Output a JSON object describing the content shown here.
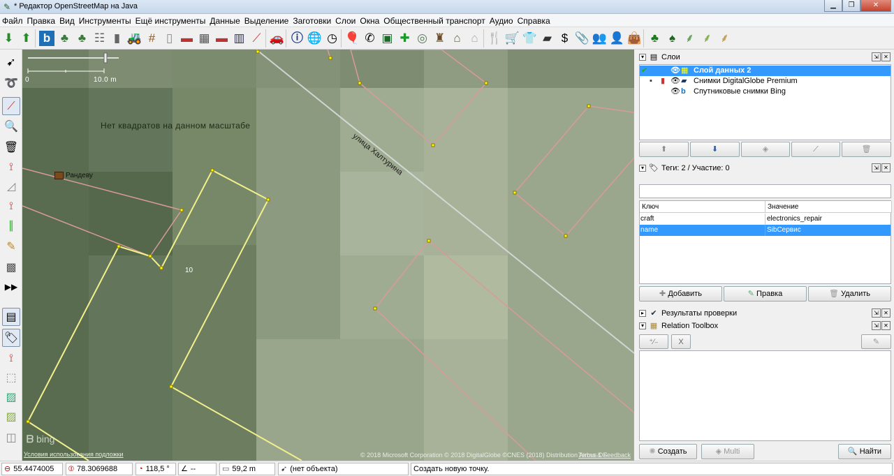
{
  "window": {
    "title": "* Редактор OpenStreetMap на Java",
    "min_icon": "minimize-icon",
    "max_icon": "maximize-icon",
    "close_icon": "close-icon"
  },
  "menu": [
    "Файл",
    "Правка",
    "Вид",
    "Инструменты",
    "Ещё инструменты",
    "Данные",
    "Выделение",
    "Заготовки",
    "Слои",
    "Окна",
    "Общественный транспорт",
    "Аудио",
    "Справка"
  ],
  "toolbar_icons": [
    "download-icon",
    "upload-icon",
    "bing-icon",
    "tree-icon",
    "tree-icon",
    "ladder-icon",
    "barrier-icon",
    "tractor-icon",
    "rails-icon",
    "hydrant-icon",
    "wall-icon",
    "fence-icon",
    "brick-icon",
    "gate-icon",
    "boom-barrier-icon",
    "car-icon",
    "info-icon",
    "globe-icon",
    "clock-icon",
    "balloons-icon",
    "phone-icon",
    "chalkboard-icon",
    "cross-icon",
    "stadium-icon",
    "castle-icon",
    "factory-icon",
    "house-icon",
    "cutlery-icon",
    "cart-icon",
    "shirt-icon",
    "car-repair-icon",
    "dollar-icon",
    "clip-icon",
    "people-icon",
    "person-icon",
    "bag-icon",
    "trees-icon",
    "forest-icon",
    "grass-icon",
    "meadow-icon",
    "wheat-icon"
  ],
  "left_tools": [
    "select-icon",
    "lasso-icon",
    "draw-icon",
    "zoom-icon",
    "delete-icon",
    "split-icon",
    "improve-way-icon",
    "extrude-icon",
    "parallel-icon",
    "pencil-icon",
    "building-icon",
    "more-icon",
    "toggle-dialogs-icon",
    "tag-panel-icon",
    "validation-icon",
    "relation-icon",
    "image-icon",
    "map-icon",
    "filter-icon"
  ],
  "map": {
    "scale_label": "10.0 m",
    "scale_zero": "0",
    "no_tiles": "Нет квадратов на данном масштабе",
    "street": "улица Халтурина",
    "poi_name": "Рандеву",
    "poi_icon": "cafe-icon",
    "house_number": "10",
    "bing_logo": "bing",
    "attribution": "© 2018 Microsoft Corporation © 2018 DigitalGlobe ©CNES (2018) Distribution Airbus DS",
    "terms": "Условия использования подложки",
    "terms_right": "Terms & Feedback"
  },
  "layers_panel": {
    "title": "Слои",
    "layers": [
      {
        "name": "Слой данных 2",
        "selected": true
      },
      {
        "name": "Снимки DigitalGlobe Premium",
        "selected": false
      },
      {
        "name": "Спутниковые снимки Bing",
        "selected": false
      }
    ],
    "buttons": [
      "move-up-icon",
      "move-down-icon",
      "merge-icon",
      "opacity-icon",
      "delete-icon"
    ]
  },
  "tags_panel": {
    "title": "Теги: 2 / Участие: 0",
    "col_key": "Ключ",
    "col_value": "Значение",
    "rows": [
      {
        "key": "craft",
        "value": "electronics_repair",
        "selected": false
      },
      {
        "key": "name",
        "value": "SibСервис",
        "selected": true
      }
    ],
    "add": "Добавить",
    "edit": "Правка",
    "delete": "Удалить"
  },
  "validation_panel": {
    "title": "Результаты проверки"
  },
  "relation_toolbox": {
    "title": "Relation Toolbox",
    "x_label": "X"
  },
  "bottom_buttons": {
    "create": "Создать",
    "multi": "Multi",
    "find": "Найти"
  },
  "status": {
    "lat": "55.4474005",
    "lon": "78.3069688",
    "heading": "118,5 °",
    "angle": "--",
    "length": "59,2 m",
    "object": "(нет объекта)",
    "hint": "Создать новую точку."
  },
  "colors": {
    "selection": "#3399ff",
    "building_way": "#f0f08a",
    "other_way": "#d99a9a"
  }
}
